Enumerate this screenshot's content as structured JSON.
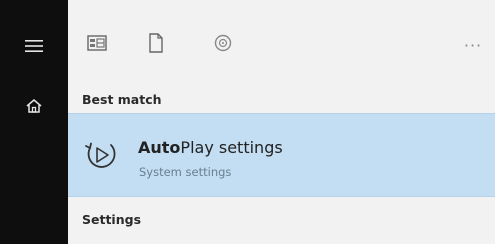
{
  "rail": {
    "items": [
      {
        "icon": "hamburger-menu-icon"
      },
      {
        "icon": "home-icon"
      }
    ]
  },
  "filters": {
    "items": [
      {
        "icon": "apps-icon"
      },
      {
        "icon": "documents-icon"
      },
      {
        "icon": "web-icon"
      }
    ],
    "more_label": "···"
  },
  "best_match": {
    "heading": "Best match",
    "result": {
      "icon": "autoplay-icon",
      "title_bold": "Auto",
      "title_rest": "Play settings",
      "subtitle": "System settings",
      "highlight_color": "#c3ddf2"
    }
  },
  "settings_section": {
    "heading": "Settings"
  }
}
